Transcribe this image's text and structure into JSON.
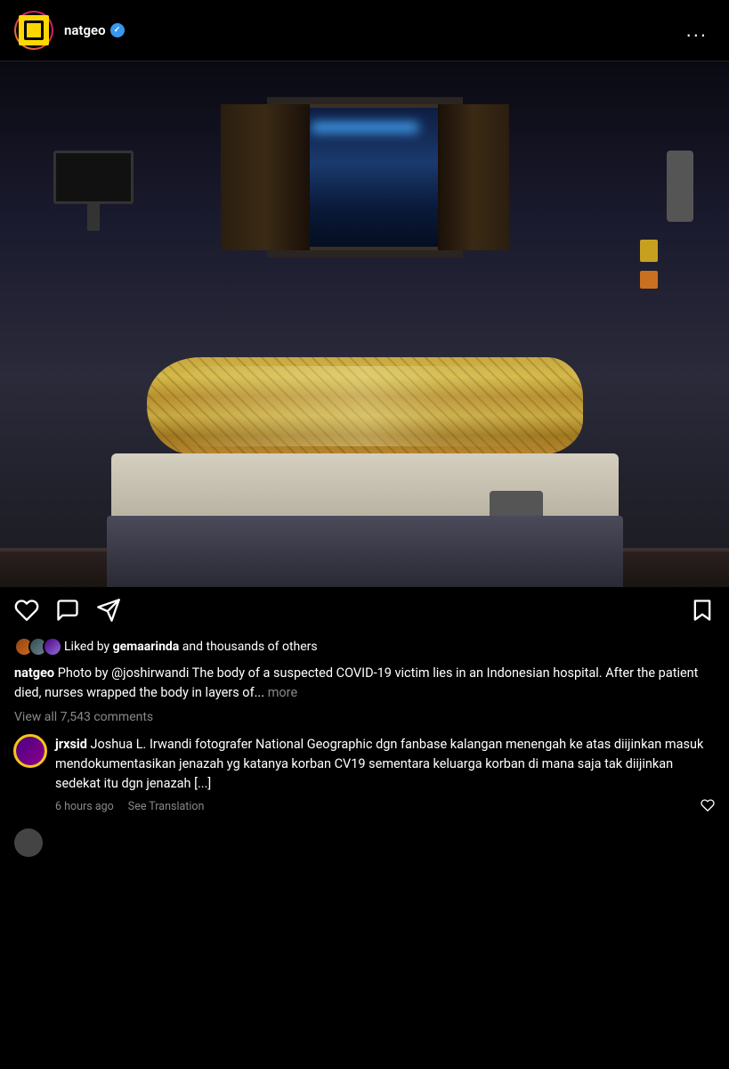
{
  "header": {
    "username": "natgeo",
    "verified": true,
    "more_label": "..."
  },
  "post": {
    "image_alt": "Hospital room with wrapped body on bed"
  },
  "actions": {
    "like_label": "like",
    "comment_label": "comment",
    "share_label": "share",
    "save_label": "save"
  },
  "likes": {
    "text": "Liked by ",
    "bold_name": "gemaarinda",
    "suffix": " and thousands of others"
  },
  "caption": {
    "username": "natgeo",
    "text": " Photo by @joshirwandi  The body of a suspected COVID-19 victim lies in an Indonesian hospital. After the patient died, nurses wrapped the body in layers of...",
    "more": " more"
  },
  "comments_link": {
    "text": "View all 7,543 comments"
  },
  "comment": {
    "username": "jrxsid",
    "text": " Joshua L. Irwandi fotografer National Geographic dgn fanbase kalangan menengah ke atas diijinkan masuk mendokumentasikan jenazah yg katanya korban CV19 sementara keluarga korban di mana saja tak diijinkan sedekat itu dgn jenazah [...]",
    "time": "6 hours ago",
    "see_translation": "See Translation"
  }
}
